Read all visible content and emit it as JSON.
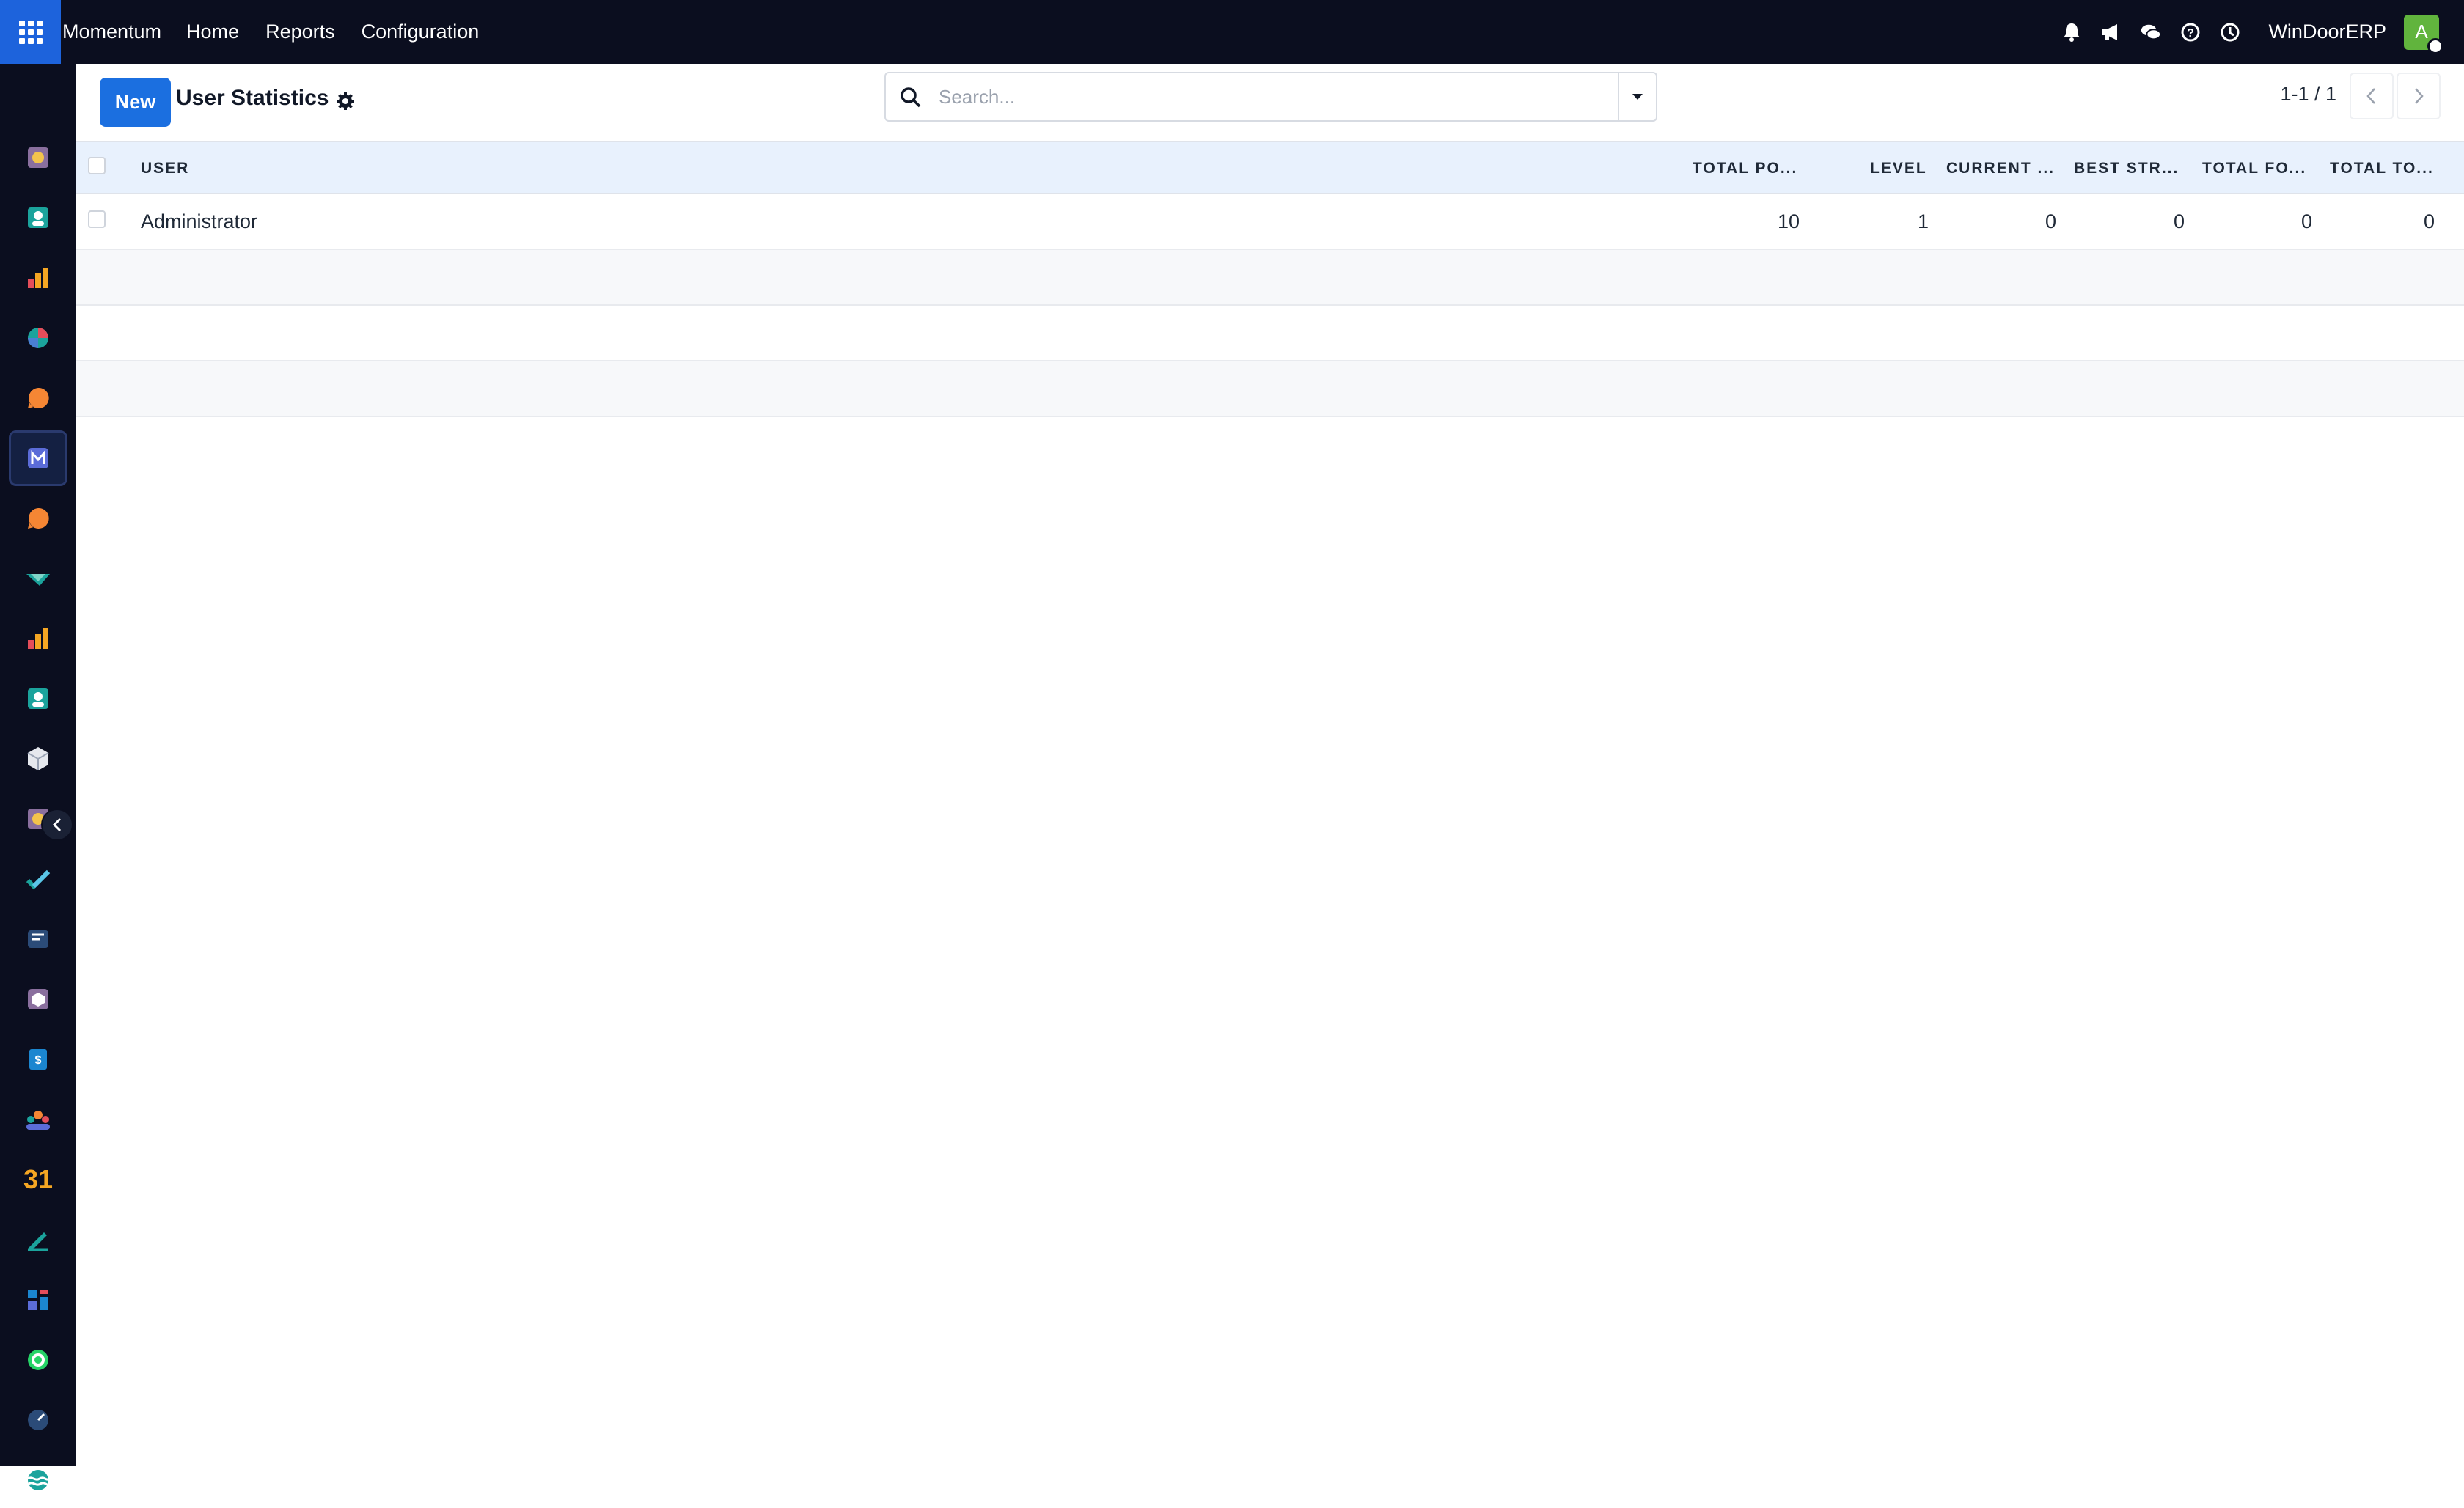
{
  "topbar": {
    "brand": "Momentum",
    "menu": [
      "Home",
      "Reports",
      "Configuration"
    ],
    "company": "WinDoorERP",
    "avatar_letter": "A",
    "icons": [
      "bell-icon",
      "megaphone-icon",
      "chat-icon",
      "help-icon",
      "clock-icon"
    ]
  },
  "sidebar": {
    "apps": [
      "app-1",
      "app-2",
      "app-3",
      "app-4",
      "app-5",
      "app-6-active",
      "app-7",
      "app-8",
      "app-9",
      "app-10",
      "app-11",
      "app-12",
      "app-13",
      "app-14",
      "app-15",
      "app-16",
      "app-17",
      "app-18",
      "app-19",
      "app-20",
      "app-21",
      "app-22",
      "app-23"
    ],
    "calendar_label": "31"
  },
  "control": {
    "new_label": "New",
    "title": "User Statistics",
    "search_placeholder": "Search...",
    "pager": "1-1 / 1"
  },
  "table": {
    "columns": [
      "USER",
      "TOTAL PO...",
      "LEVEL",
      "CURRENT ...",
      "BEST STR...",
      "TOTAL FO...",
      "TOTAL TO..."
    ],
    "rows": [
      [
        "Administrator",
        "10",
        "1",
        "0",
        "0",
        "0",
        "0"
      ]
    ]
  },
  "colors": {
    "navbar": "#0b0e1f",
    "primary": "#1b6fe0",
    "header_bg": "#e8f1fd",
    "avatar": "#61b43d"
  }
}
